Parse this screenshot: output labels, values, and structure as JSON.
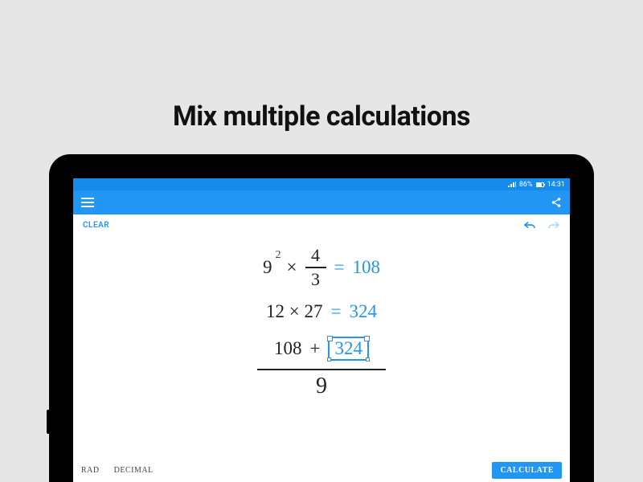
{
  "headline": "Mix multiple calculations",
  "statusbar": {
    "battery_pct": "86%",
    "time": "14:31"
  },
  "toolbar": {
    "clear": "CLEAR"
  },
  "equations": {
    "row1": {
      "base": "9",
      "exponent": "2",
      "op": "×",
      "frac_num": "4",
      "frac_den": "3",
      "eq": "=",
      "result": "108"
    },
    "row2": {
      "lhs": "12 × 27",
      "eq": "=",
      "result": "324"
    },
    "row3": {
      "a": "108",
      "op": "+",
      "b": "324",
      "denominator": "9"
    }
  },
  "bottombar": {
    "angle_mode": "RAD",
    "number_mode": "DECIMAL",
    "calculate": "CALCULATE"
  }
}
